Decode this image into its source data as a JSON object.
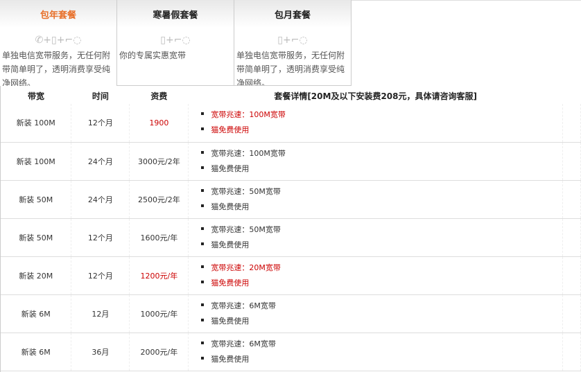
{
  "tabs": [
    {
      "title": "包年套餐",
      "icons": "✆+▯+⌐◌",
      "desc": "单独电信宽带服务，无任何附带简单明了，透明消费享受纯净网络。"
    },
    {
      "title": "寒暑假套餐",
      "icons": "▯+⌐◌",
      "desc": "你的专属实惠宽带"
    },
    {
      "title": "包月套餐",
      "icons": "▯+⌐◌",
      "desc": "单独电信宽带服务，无任何附带简单明了，透明消费享受纯净网络。"
    }
  ],
  "table": {
    "headers": [
      "带宽",
      "时间",
      "资费",
      "套餐详情[20M及以下安装费208元，具体请咨询客服]"
    ],
    "rows": [
      {
        "bandwidth": "新装 100M",
        "period": "12个月",
        "price": "1900",
        "d1": "宽带兆速：100M宽带",
        "d2": "猫免费使用",
        "highlight": true,
        "price_red": true
      },
      {
        "bandwidth": "新装 100M",
        "period": "24个月",
        "price": "3000元/2年",
        "d1": "宽带兆速：100M宽带",
        "d2": "猫免费使用",
        "highlight": false,
        "price_red": false
      },
      {
        "bandwidth": "新装 50M",
        "period": "24个月",
        "price": "2500元/2年",
        "d1": "宽带兆速：50M宽带",
        "d2": "猫免费使用",
        "highlight": false,
        "price_red": false
      },
      {
        "bandwidth": "新装 50M",
        "period": "12个月",
        "price": "1600元/年",
        "d1": "宽带兆速：50M宽带",
        "d2": "猫免费使用",
        "highlight": false,
        "price_red": false
      },
      {
        "bandwidth": "新装 20M",
        "period": "12个月",
        "price": "1200元/年",
        "d1": "宽带兆速：20M宽带",
        "d2": "猫免费使用",
        "highlight": true,
        "price_red": true
      },
      {
        "bandwidth": "新装 6M",
        "period": "12月",
        "price": "1000元/年",
        "d1": "宽带兆速：6M宽带",
        "d2": "猫免费使用",
        "highlight": false,
        "price_red": false
      },
      {
        "bandwidth": "新装 6M",
        "period": "36月",
        "price": "2000元/年",
        "d1": "宽带兆速：6M宽带",
        "d2": "猫免费使用",
        "highlight": false,
        "price_red": false
      }
    ]
  }
}
